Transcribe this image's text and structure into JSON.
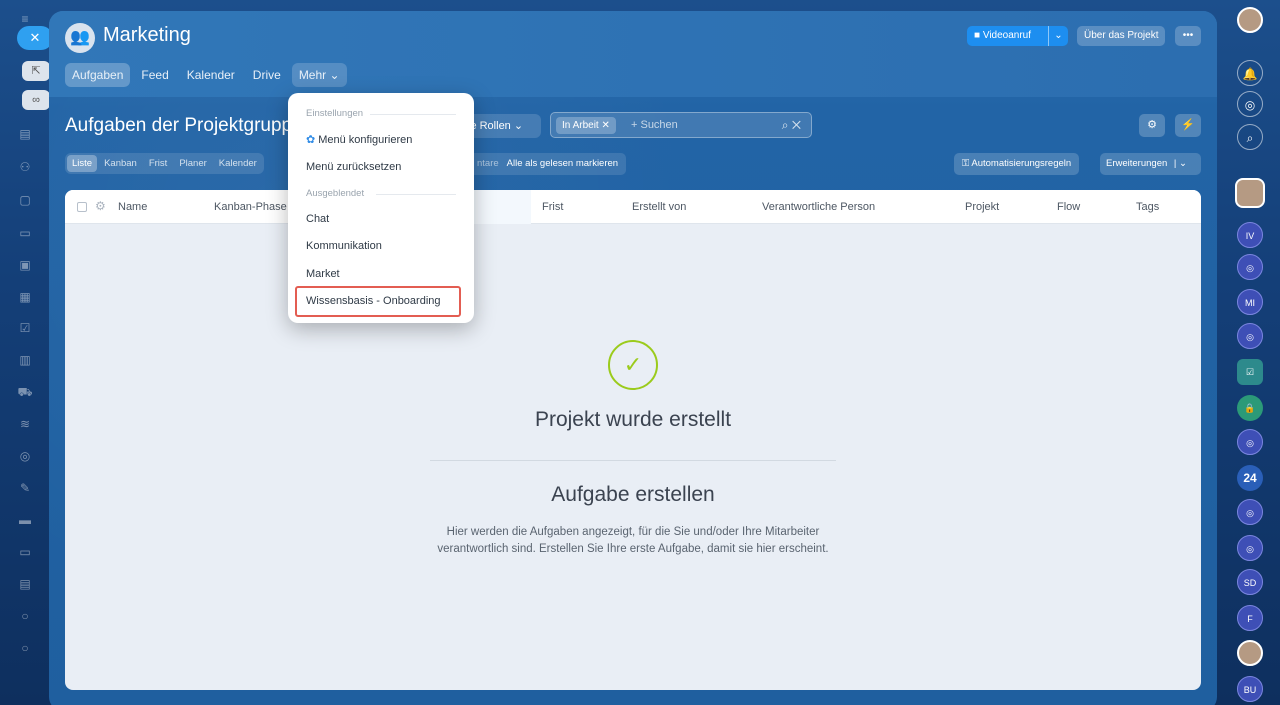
{
  "project": {
    "name": "Marketing"
  },
  "header": {
    "video_call_label": "Videoanruf",
    "about_label": "Über das Projekt",
    "more_label": "•••"
  },
  "nav": {
    "items": [
      "Aufgaben",
      "Feed",
      "Kalender",
      "Drive",
      "Mehr"
    ]
  },
  "toolbar": {
    "page_title": "Aufgaben der Projektgrupp",
    "roles_label": "le Rollen",
    "filter_tag": "In Arbeit",
    "search_placeholder": "+ Suchen"
  },
  "views": {
    "tabs": [
      "Liste",
      "Kanban",
      "Frist",
      "Planer",
      "Kalender"
    ],
    "comments_partial": "ntare",
    "mark_all_read": "Alle als gelesen markieren",
    "automation_label": "Automatisierungsregeln",
    "extensions_label": "Erweiterungen"
  },
  "table": {
    "columns": [
      "Name",
      "Kanban-Phase",
      "Frist",
      "Erstellt von",
      "Verantwortliche Person",
      "Projekt",
      "Flow",
      "Tags"
    ]
  },
  "empty_state": {
    "success_title": "Projekt wurde erstellt",
    "create_title": "Aufgabe erstellen",
    "description": "Hier werden die Aufgaben angezeigt, für die Sie und/oder Ihre Mitarbeiter verantwortlich sind. Erstellen Sie Ihre erste Aufgabe, damit sie hier erscheint."
  },
  "menu": {
    "settings_header": "Einstellungen",
    "configure_label": "Menü konfigurieren",
    "reset_label": "Menü zurücksetzen",
    "hidden_header": "Ausgeblendet",
    "hidden_items": [
      "Chat",
      "Kommunikation",
      "Market",
      "Wissensbasis - Onboarding"
    ]
  },
  "right_rail": {
    "initials": [
      "IV",
      "MI",
      "24",
      "SD",
      "F",
      "BU"
    ]
  },
  "colors": {
    "accent": "#1d8ef0",
    "success": "#9bcb1c",
    "highlight_border": "#e35d52"
  }
}
